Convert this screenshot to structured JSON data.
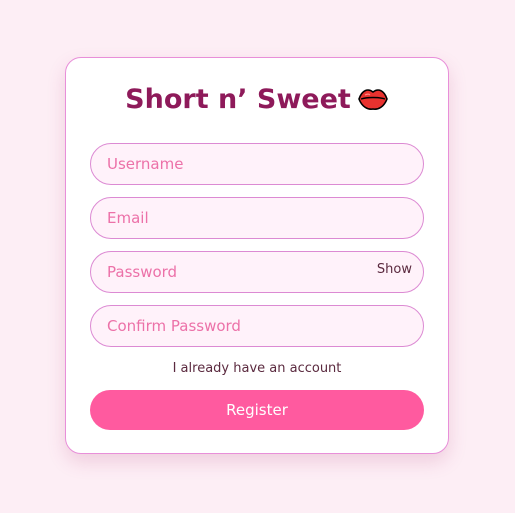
{
  "form": {
    "title": "Short n’ Sweet",
    "title_icon": "lips-emoji",
    "username_placeholder": "Username",
    "email_placeholder": "Email",
    "password_placeholder": "Password",
    "password_toggle_label": "Show",
    "confirm_password_placeholder": "Confirm Password",
    "login_link": "I already have an account",
    "register_label": "Register"
  },
  "colors": {
    "page_background": "#fdeef5",
    "title": "#8e1a5a",
    "accent": "#ff5a9f",
    "input_border": "#dc8ad3",
    "placeholder": "#ec71a8"
  }
}
